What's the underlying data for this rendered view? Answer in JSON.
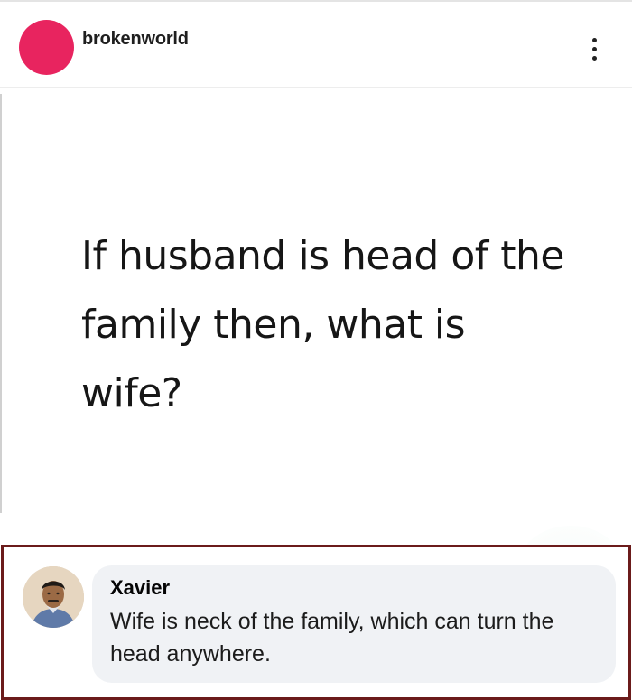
{
  "post": {
    "username": "brokenworld",
    "avatar_color": "#e8245f",
    "menu_icon": "more-vertical-icon",
    "text": "If husband is head of the family then, what is wife?"
  },
  "comment": {
    "author": "Xavier",
    "text": "Wife is neck of the family, which can turn the head anywhere.",
    "highlight_border_color": "#6b1b1b",
    "bubble_color": "#f0f2f5"
  }
}
